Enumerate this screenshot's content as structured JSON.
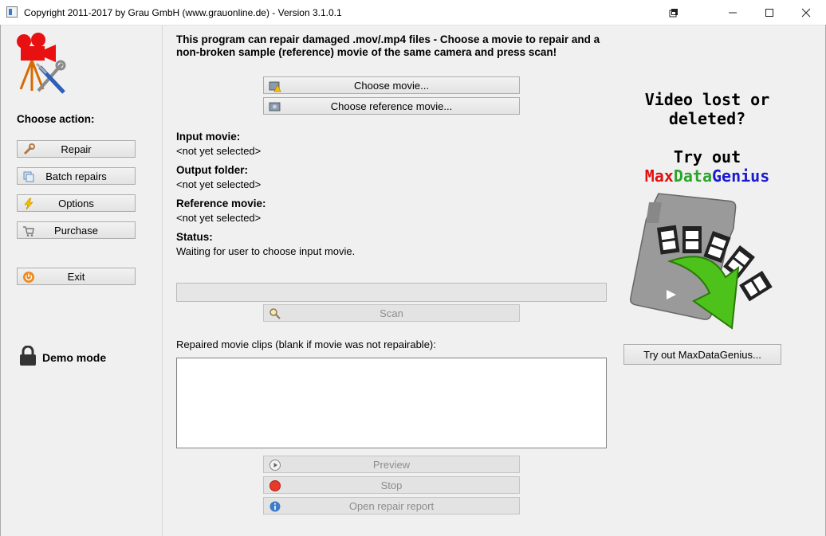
{
  "window": {
    "title": "Copyright 2011-2017 by Grau GmbH (www.grauonline.de) - Version 3.1.0.1",
    "controls": [
      "resize-icon",
      "minimize-icon",
      "maximize-icon",
      "close-icon"
    ]
  },
  "sidebar": {
    "heading": "Choose action:",
    "buttons": [
      {
        "label": "Repair",
        "icon": "wrench-icon"
      },
      {
        "label": "Batch repairs",
        "icon": "batch-icon"
      },
      {
        "label": "Options",
        "icon": "lightning-icon"
      },
      {
        "label": "Purchase",
        "icon": "cart-icon"
      }
    ],
    "exit_label": "Exit",
    "demo_label": "Demo mode"
  },
  "main": {
    "intro": "This program can repair damaged .mov/.mp4 files - Choose a movie to repair and a non-broken sample (reference) movie of the same camera and press scan!",
    "choose_movie": "Choose movie...",
    "choose_reference": "Choose reference movie...",
    "input_label": "Input movie:",
    "input_value": "<not yet selected>",
    "output_label": "Output folder:",
    "output_value": "<not yet selected>",
    "reference_label": "Reference movie:",
    "reference_value": "<not yet selected>",
    "status_label": "Status:",
    "status_value": "Waiting for user to choose input movie.",
    "progress": 0,
    "scan": "Scan",
    "clips_label": "Repaired movie clips (blank if movie was not repairable):",
    "preview": "Preview",
    "stop": "Stop",
    "report": "Open repair report"
  },
  "ad": {
    "line1a": "Video lost or",
    "line1b": "deleted?",
    "line2": "Try out",
    "brand_parts": [
      {
        "text": "Max",
        "color": "#e01010"
      },
      {
        "text": "Data",
        "color": "#2aa52a"
      },
      {
        "text": "Genius",
        "color": "#1a1ad0"
      }
    ],
    "button": "Try out MaxDataGenius..."
  }
}
